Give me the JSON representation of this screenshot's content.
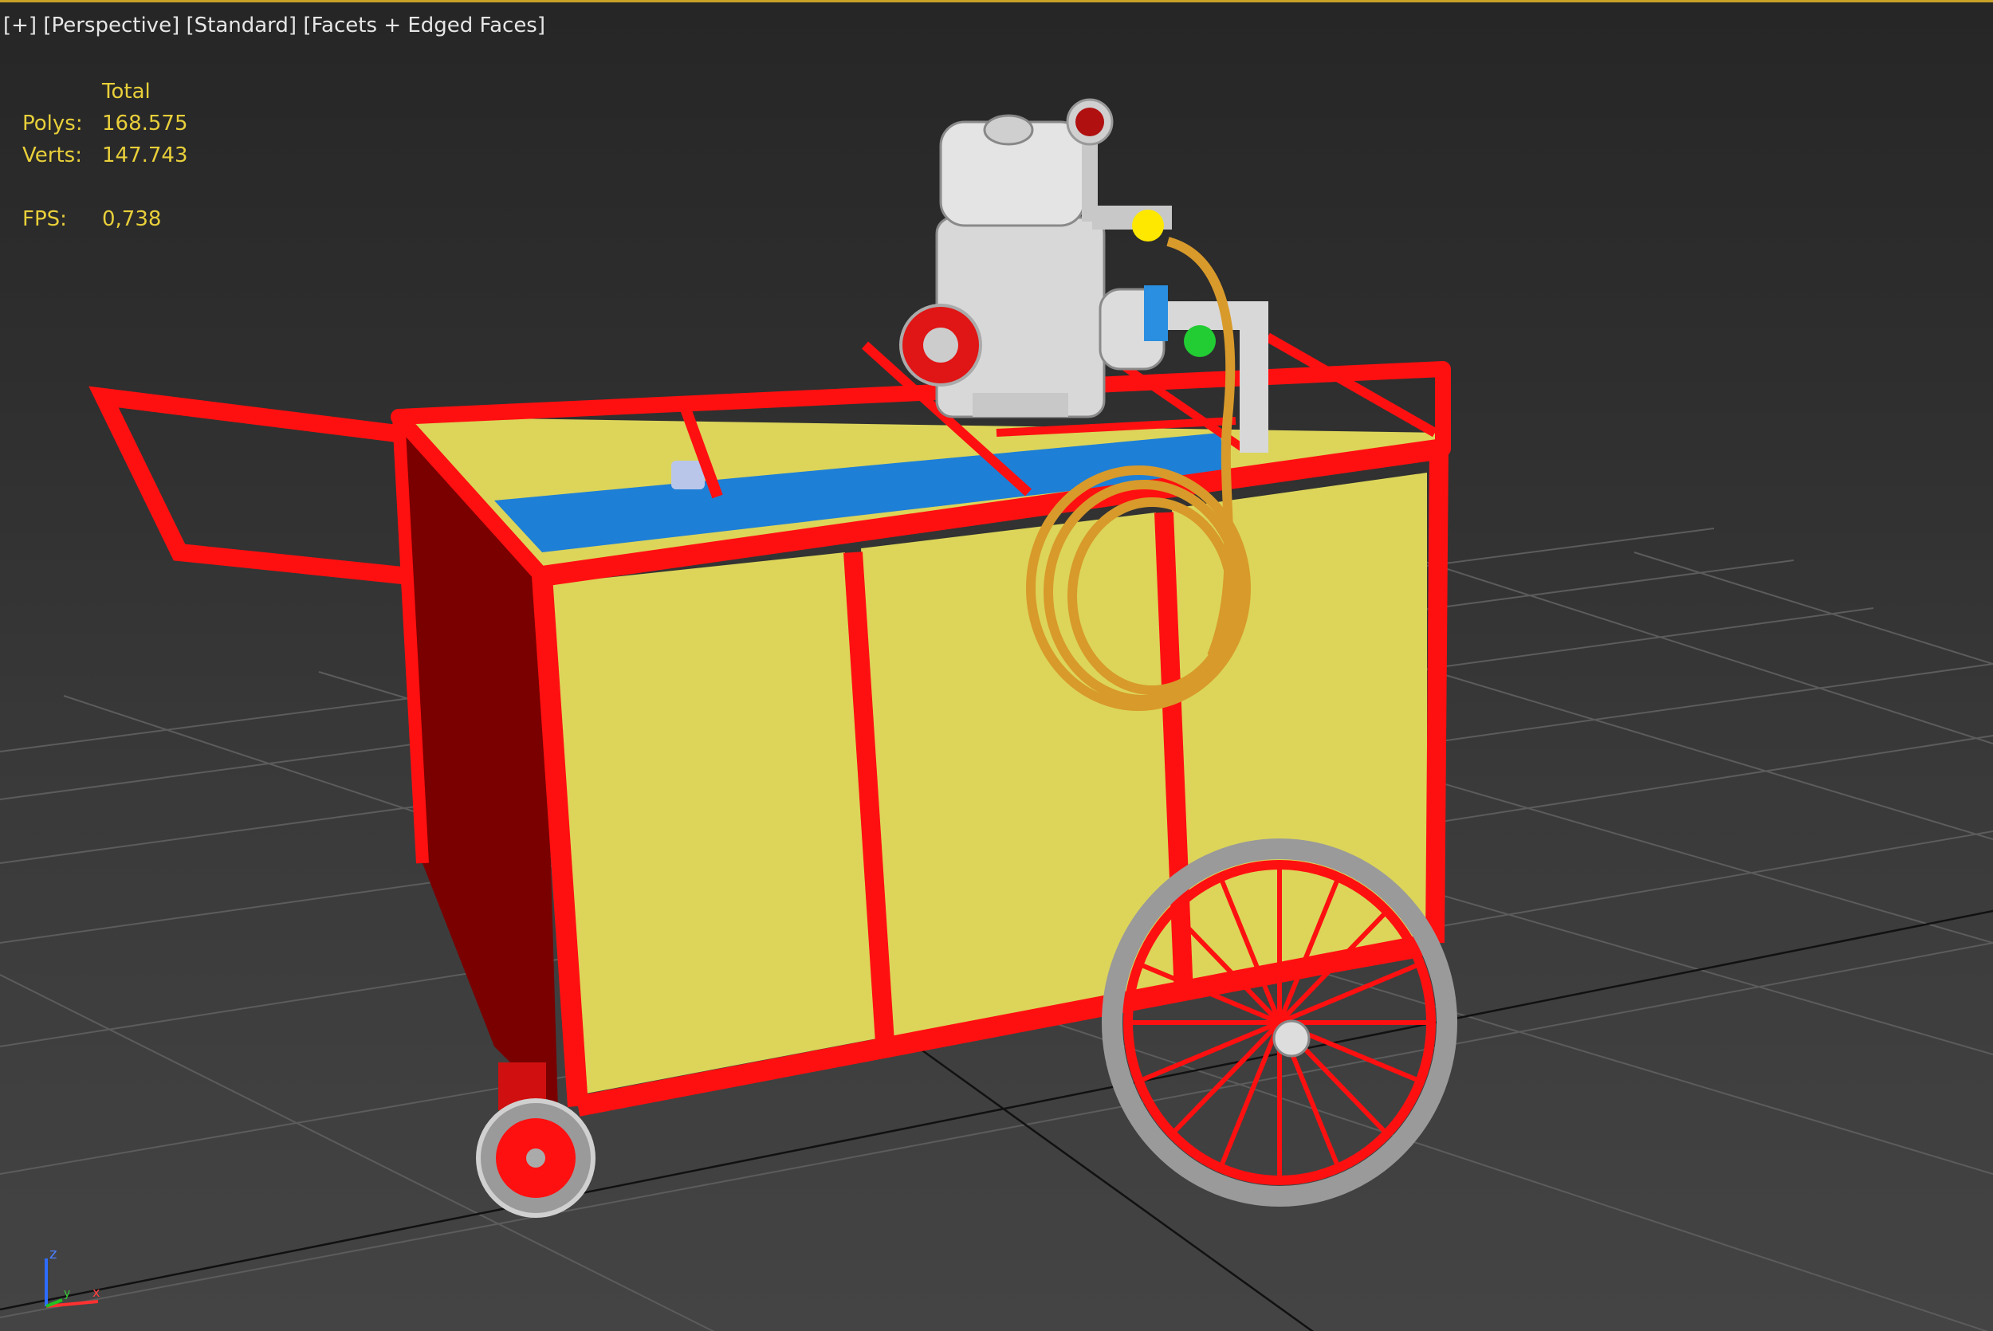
{
  "viewport": {
    "label_plus": "[+]",
    "label_view": "[Perspective]",
    "label_shading": "[Standard]",
    "label_mode": "[Facets + Edged Faces]"
  },
  "stats": {
    "header": "Total",
    "polys_label": "Polys:",
    "polys_value": "168.575",
    "verts_label": "Verts:",
    "verts_value": "147.743",
    "fps_label": "FPS:",
    "fps_value": "0,738"
  },
  "axis": {
    "z": "z",
    "x": "x",
    "y": "y"
  },
  "colors": {
    "frame": "#ff0000",
    "panel": "#dcd55a",
    "water": "#1e7fd6",
    "hose": "#d89a2a",
    "engine": "#d8d8d8",
    "stats_text": "#e8cf3a",
    "grid": "#5a5a5a"
  }
}
